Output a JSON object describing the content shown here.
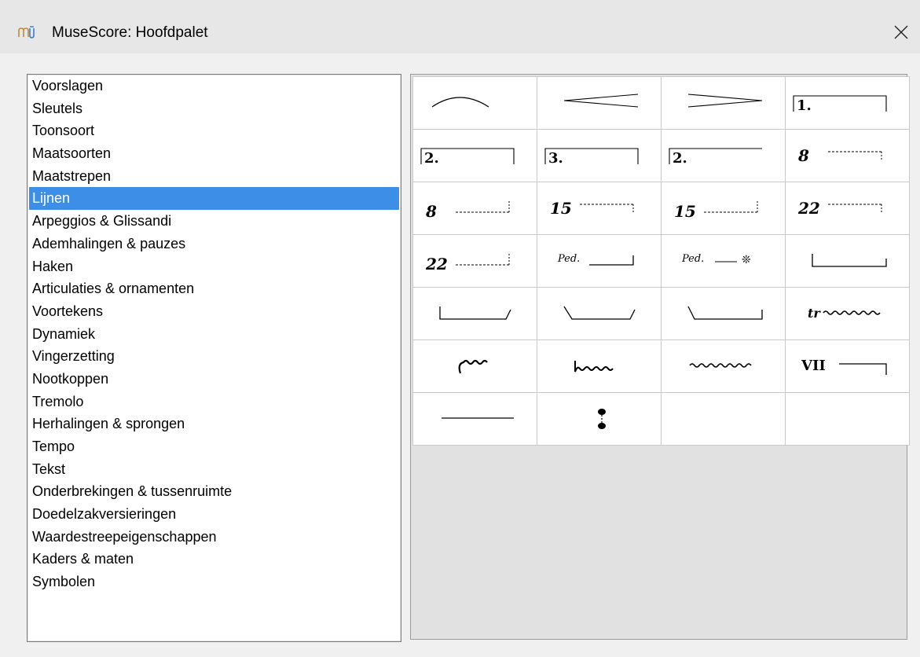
{
  "window": {
    "title": "MuseScore: Hoofdpalet",
    "logo_icon": "musescore-logo-icon",
    "close_icon": "close-icon"
  },
  "categories": {
    "selected_index": 5,
    "items": [
      "Voorslagen",
      "Sleutels",
      "Toonsoort",
      "Maatsoorten",
      "Maatstrepen",
      "Lijnen",
      "Arpeggios & Glissandi",
      "Ademhalingen & pauzes",
      "Haken",
      "Articulaties & ornamenten",
      "Voortekens",
      "Dynamiek",
      "Vingerzetting",
      "Nootkoppen",
      "Tremolo",
      "Herhalingen & sprongen",
      "Tempo",
      "Tekst",
      "Onderbrekingen & tussenruimte",
      "Doedelzakversieringen",
      "Waardestreepeigenschappen",
      "Kaders & maten",
      "Symbolen"
    ]
  },
  "palette": {
    "cells": [
      {
        "icon": "slur-icon",
        "text": ""
      },
      {
        "icon": "crescendo-hairpin-icon",
        "text": ""
      },
      {
        "icon": "diminuendo-hairpin-icon",
        "text": ""
      },
      {
        "icon": "volta-icon",
        "text": "1."
      },
      {
        "icon": "volta-icon",
        "text": "2."
      },
      {
        "icon": "volta-icon",
        "text": "3."
      },
      {
        "icon": "volta-open-icon",
        "text": "2."
      },
      {
        "icon": "ottava-alta-icon",
        "text": "8"
      },
      {
        "icon": "ottava-bassa-icon",
        "text": "8"
      },
      {
        "icon": "ottava-alta-icon",
        "text": "15"
      },
      {
        "icon": "ottava-bassa-icon",
        "text": "15"
      },
      {
        "icon": "ottava-alta-icon",
        "text": "22"
      },
      {
        "icon": "ottava-bassa-icon",
        "text": "22"
      },
      {
        "icon": "pedal-line-icon",
        "text": "Ped."
      },
      {
        "icon": "pedal-asterisk-icon",
        "text": "Ped."
      },
      {
        "icon": "pedal-bracket-icon",
        "text": ""
      },
      {
        "icon": "pedal-bracket-angled-end-icon",
        "text": ""
      },
      {
        "icon": "pedal-bracket-angled-both-icon",
        "text": ""
      },
      {
        "icon": "pedal-bracket-angled-start-icon",
        "text": ""
      },
      {
        "icon": "trill-line-icon",
        "text": "tr"
      },
      {
        "icon": "upprall-line-icon",
        "text": ""
      },
      {
        "icon": "downprall-line-icon",
        "text": ""
      },
      {
        "icon": "prallprall-line-icon",
        "text": ""
      },
      {
        "icon": "let-ring-vii-icon",
        "text": "VII"
      },
      {
        "icon": "plain-line-icon",
        "text": ""
      },
      {
        "icon": "ambitus-icon",
        "text": ""
      },
      {
        "icon": "empty-cell",
        "text": ""
      },
      {
        "icon": "empty-cell",
        "text": ""
      }
    ]
  }
}
